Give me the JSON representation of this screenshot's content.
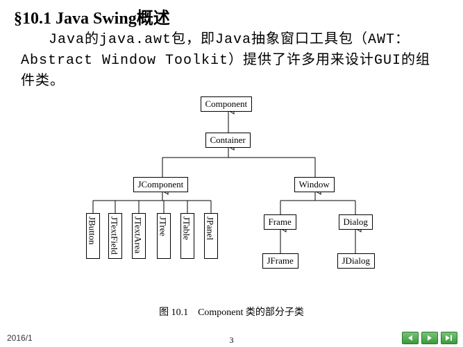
{
  "title": "§10.1  Java Swing概述",
  "paragraph": "Java的java.awt包，即Java抽象窗口工具包（AWT：Abstract Window Toolkit）提供了许多用来设计GUI的组件类。",
  "diagram": {
    "component": "Component",
    "container": "Container",
    "jcomponent": "JComponent",
    "window": "Window",
    "frame": "Frame",
    "dialog": "Dialog",
    "jframe": "JFrame",
    "jdialog": "JDialog",
    "jbutton": "JButton",
    "jtextfield": "JTextField",
    "jtextarea": "JTextArea",
    "jtree": "JTree",
    "jtable": "JTable",
    "jpanel": "JPanel"
  },
  "caption": "图 10.1　Component 类的部分子类",
  "date": "2016/1",
  "page": "3"
}
